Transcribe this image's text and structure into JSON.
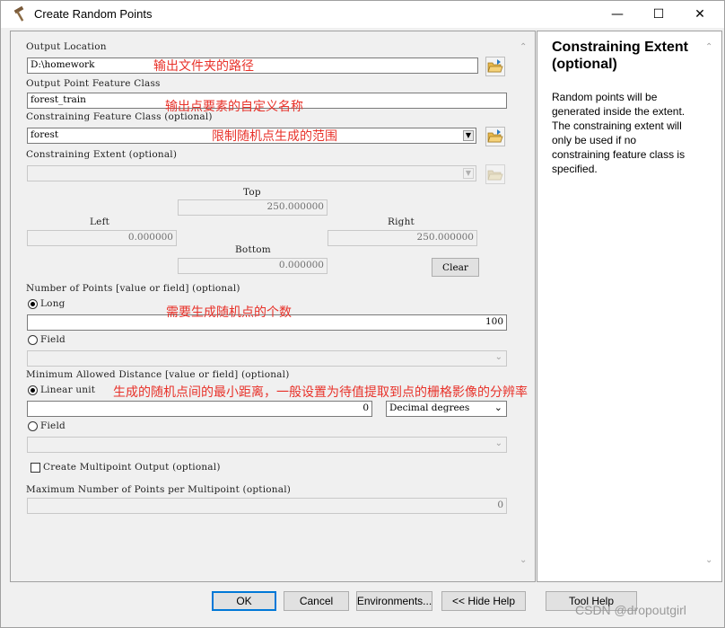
{
  "window": {
    "title": "Create Random Points",
    "minimize_glyph": "—",
    "maximize_glyph": "☐",
    "close_glyph": "✕"
  },
  "form": {
    "output_location": {
      "label": "Output Location",
      "value": "D:\\homework"
    },
    "output_feature_class": {
      "label": "Output Point Feature Class",
      "value": "forest_train"
    },
    "constraining_feature_class": {
      "label": "Constraining Feature Class (optional)",
      "value": "forest"
    },
    "constraining_extent": {
      "label": "Constraining Extent (optional)",
      "value": "",
      "top_label": "Top",
      "top_value": "250.000000",
      "left_label": "Left",
      "left_value": "0.000000",
      "right_label": "Right",
      "right_value": "250.000000",
      "bottom_label": "Bottom",
      "bottom_value": "0.000000",
      "clear_label": "Clear"
    },
    "number_of_points": {
      "label": "Number of Points [value or field] (optional)",
      "long_label": "Long",
      "long_value": "100",
      "long_selected": true,
      "field_label": "Field",
      "field_value": ""
    },
    "min_distance": {
      "label": "Minimum Allowed Distance [value or field] (optional)",
      "linear_label": "Linear unit",
      "linear_value": "0",
      "linear_selected": true,
      "unit_value": "Decimal degrees",
      "field_label": "Field",
      "field_value": ""
    },
    "multipoint": {
      "label": "Create Multipoint Output (optional)",
      "checked": false
    },
    "max_points_per_multipoint": {
      "label": "Maximum Number of Points per Multipoint (optional)",
      "value": "0"
    }
  },
  "annotations": {
    "a1": "输出文件夹的路径",
    "a2": "输出点要素的自定义名称",
    "a3": "限制随机点生成的范围",
    "a4": "需要生成随机点的个数",
    "a5": "生成的随机点间的最小距离，一般设置为待值提取到点的栅格影像的分辨率"
  },
  "help": {
    "title": "Constraining Extent (optional)",
    "body": "Random points will be generated inside the extent. The constraining extent will only be used if no constraining feature class is specified."
  },
  "buttons": {
    "ok": "OK",
    "cancel": "Cancel",
    "environments": "Environments...",
    "hide_help": "<< Hide Help",
    "tool_help": "Tool Help"
  },
  "watermark": "CSDN @dropoutgirl",
  "colors": {
    "annotation": "#e8322a",
    "default_button_border": "#0078d7"
  },
  "icons": {
    "title": "hammer-icon",
    "browse": "folder-open-icon",
    "dropdown": "chevron-down-icon"
  }
}
